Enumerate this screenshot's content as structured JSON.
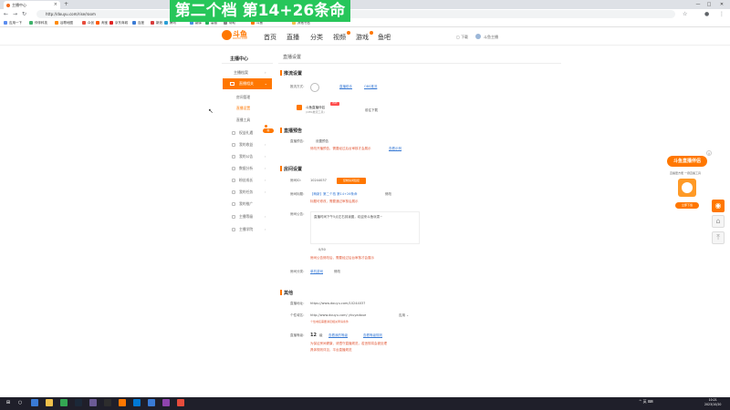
{
  "browser": {
    "tab_title": "主播中心",
    "tab_close": "×",
    "new_tab": "+",
    "url": "http://douyu.com/rise/room",
    "bookmarks": [
      "应用一下",
      "伴伴科技",
      "谷歌地图",
      "众创",
      "淘宝",
      "京东商城",
      "百度",
      "新浪",
      "腾讯",
      "翻译",
      "高德",
      "帮助",
      "斗鱼",
      "其他书签"
    ]
  },
  "overlay": {
    "title": "第二个档 第14+26条命"
  },
  "site": {
    "logo_text": "斗鱼",
    "logo_sub": "DOUYU.COM",
    "nav": [
      "首页",
      "直播",
      "分类",
      "视频",
      "游戏",
      "鱼吧"
    ],
    "right": [
      "下载",
      "斗鱼主播"
    ]
  },
  "sidebar": {
    "title": "主播中心",
    "items_top": [
      "主播档案"
    ],
    "active": "直播相关",
    "subs": [
      "房间管理",
      "直播设置",
      "直播工具"
    ],
    "current_sub": "直播设置",
    "rows": [
      "权益礼遇",
      "我的收益",
      "我的公告",
      "数据分析",
      "粉丝成长",
      "我的任务",
      "我的推广",
      "主播等级",
      "主播学院"
    ],
    "new_badge": "新",
    "chevron": "›"
  },
  "main": {
    "page_tab": "直播设置",
    "sec1": {
      "title": "推流设置",
      "label": "推流方式：",
      "link1": "直播助手",
      "link2": "OBS推流",
      "obs_title": "斗鱼直播伴侣",
      "obs_sub": "(OBS推流工具)",
      "hot": "HOT",
      "download": "前往下载"
    },
    "sec2": {
      "title": "直播预告",
      "label": "直播预告：",
      "value": "设置预告",
      "warn": "修改开播预告，需要经过后台审核才会展示",
      "link": "查看示例"
    },
    "sec3": {
      "title": "房间设置",
      "room_label": "房间ID：",
      "room_id": "10244037",
      "btn": "复制房间链接",
      "name_label": "房间标题：",
      "name_value": "【萌新】第二个档 第14+26条命",
      "edit": "修改",
      "name_warn": "标题可修改，需要通过审核后展示",
      "notice_label": "房间公告：",
      "notice_value": "直播时间下午5点左右到凌晨，欢迎来斗鱼玩耍~",
      "count": "0/50",
      "notice_warn": "房间公告修改后，需要经过后台审核才会展示",
      "cat_label": "房间分类：",
      "cat_value": "单机游戏",
      "cat_edit": "修改"
    },
    "sec4": {
      "title": "其他",
      "url_label": "直播地址：",
      "url_value": "https://www.douyu.com/10244037",
      "personal_label": "个性域名：",
      "personal_value": "http://www.douyu.com/ yhuyadoue",
      "personal_btn": "应用",
      "personal_hint": "个性域名需要满足相关申请条件",
      "level_label": "直播等级：",
      "level_value": "12",
      "level_unit": "级",
      "level_link1": "查看我的等级",
      "level_link2": "查看等级规则",
      "level_warn1": "为保证房间健康，请遵守直播规范，若违规将会被处理",
      "level_warn2": "具体规则详见，平台直播规范"
    }
  },
  "float_widget": {
    "title": "斗鱼直播伴侣",
    "sub": "直播更方便  一键直播工具",
    "btn": "立即下载",
    "close": "×"
  },
  "side_icons": [
    "◉",
    "⌂",
    "⤒"
  ],
  "taskbar": {
    "start": "⊞",
    "search": "○",
    "sys": "^ 英 ⌨",
    "time": "10:21",
    "date": "2023/10/20"
  }
}
